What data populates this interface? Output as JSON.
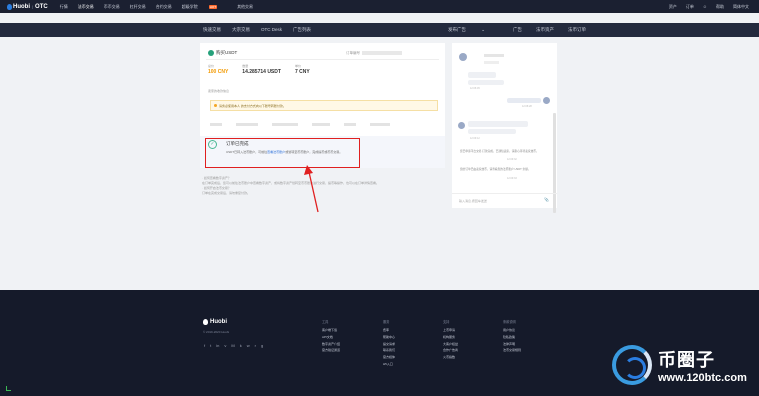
{
  "topnav": {
    "logo_brand": "Huobi",
    "logo_sub": "OTC",
    "items": [
      "行情",
      "法币交易",
      "币币交易",
      "杠杆交易",
      "合约交易",
      "超级学院",
      "其他交易"
    ],
    "active_index": 1,
    "hot_badge": "HOT",
    "right": [
      "资产",
      "订单",
      "帮助",
      "简体中文"
    ]
  },
  "subnav": {
    "left": [
      "快速交易",
      "大宗交易",
      "OTC Desk",
      "广告列表"
    ],
    "right": [
      "发布广告",
      "广告",
      "法币资产",
      "法币订单"
    ]
  },
  "order": {
    "title": "购买USDT",
    "order_no_label": "订单编号",
    "metrics": [
      {
        "label": "总价",
        "value": "100 CNY",
        "accent": true
      },
      {
        "label": "数量",
        "value": "14.285714 USDT",
        "accent": false
      },
      {
        "label": "单价",
        "value": "7 CNY",
        "accent": false
      }
    ],
    "seller_label": "卖家的收款信息",
    "warning": "请务必使用本人          的支付方式向以下账号转账付款。",
    "success_title": "订单已完成",
    "success_desc_prefix": "USDT已转入法币账户，可前往",
    "success_desc_link": "查看法币账户",
    "success_desc_suffix": "或划转至币币账户，完成提币或币币交易。"
  },
  "notes": [
    "· 如何查看数字资产？",
    "  在订单完成后，您可以前往法币账户中查看数字资产，或将数字资产划转至币币账户进行交易，提币等操作，也可以在订单详情查看。",
    "· 如何开启法币交易？",
    "  订单在完成交易后，请勿重复付款。"
  ],
  "chat": {
    "ts1": "12:06:45",
    "ts2": "12:08:28",
    "ts3": "12:09:12",
    "sys1": "您已申诉平台交易 打款完成，已通知卖家，请耐心等待卖家放币。",
    "sys1_time": "12:09:32",
    "sys2": "您的订单已由卖家放币，请查看您的法币账户 USDT 余额。",
    "sys2_time": "12:09:33",
    "input_placeholder": "输入消息,按回车发送"
  },
  "footer": {
    "brand": "Huobi",
    "copyright": "© 2019-2020 Huobi",
    "socials": [
      "f",
      "t",
      "in",
      "v",
      "M",
      "k",
      "w",
      "r",
      "g"
    ],
    "columns": [
      {
        "heading": "工具",
        "items": [
          "客户端下载",
          "API文档",
          "数字资产介绍",
          "官方验证通道"
        ]
      },
      {
        "heading": "服务",
        "items": [
          "费率",
          "帮助中心",
          "提交请求",
          "联系我们",
          "官方媒体",
          "H5入口"
        ]
      },
      {
        "heading": "支持",
        "items": [
          "上币申请",
          "机构服务",
          "大客户权益",
          "合作广告商",
          "火币指数"
        ]
      },
      {
        "heading": "条款说明",
        "items": [
          "用户协议",
          "隐私政策",
          "法律声明",
          "法币交易规则"
        ]
      }
    ]
  },
  "watermark": {
    "brand": "币圈子",
    "url": "www.120btc.com"
  }
}
